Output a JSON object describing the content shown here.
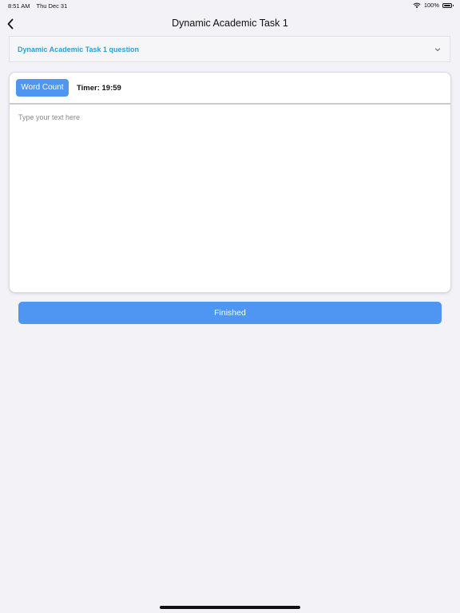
{
  "status_bar": {
    "time": "8:51 AM",
    "date": "Thu Dec 31",
    "battery": "100%",
    "wifi_icon": "wifi-icon",
    "battery_icon": "battery-icon"
  },
  "nav": {
    "title": "Dynamic Academic Task 1",
    "back_icon": "chevron-left-icon"
  },
  "question": {
    "title": "Dynamic Academic Task 1 question",
    "expand_icon": "chevron-down-icon"
  },
  "editor": {
    "word_count_label": "Word Count",
    "timer_label": "Timer: 19:59",
    "placeholder": "Type your text here",
    "value": ""
  },
  "actions": {
    "finished_label": "Finished"
  },
  "colors": {
    "accent": "#4e96f2",
    "question_link": "#2e9fd0",
    "background": "#f2f2f7"
  }
}
